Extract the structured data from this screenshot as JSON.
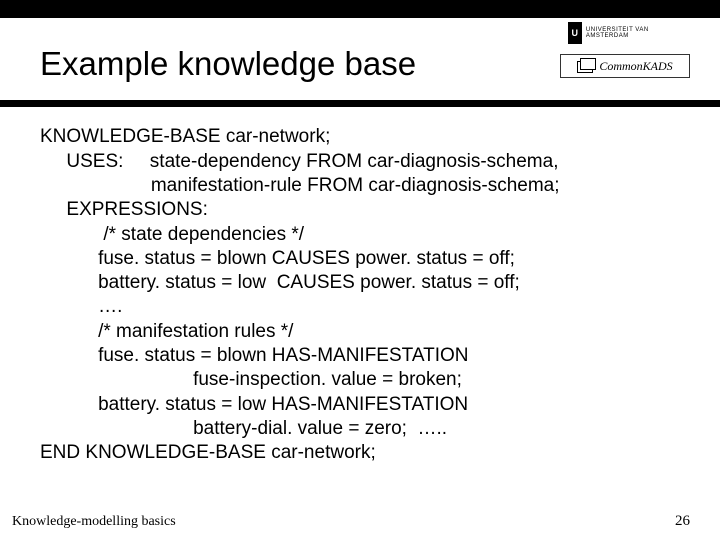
{
  "header": {
    "title": "Example knowledge base"
  },
  "logos": {
    "uva_text": "UNIVERSITEIT VAN AMSTERDAM",
    "ck_text": "CommonKADS"
  },
  "kb": {
    "line1": "KNOWLEDGE-BASE car-network;",
    "line2": "     USES:     state-dependency FROM car-diagnosis-schema,",
    "line3": "                     manifestation-rule FROM car-diagnosis-schema;",
    "line4": "     EXPRESSIONS:",
    "line5": "            /* state dependencies */",
    "line6": "           fuse. status = blown CAUSES power. status = off;",
    "line7": "           battery. status = low  CAUSES power. status = off;",
    "line8": "           ….",
    "line9": "           /* manifestation rules */",
    "line10": "           fuse. status = blown HAS-MANIFESTATION",
    "line11": "                             fuse-inspection. value = broken;",
    "line12": "           battery. status = low HAS-MANIFESTATION",
    "line13": "                             battery-dial. value = zero;  …..",
    "line14": "END KNOWLEDGE-BASE car-network;"
  },
  "footer": {
    "left": "Knowledge-modelling basics",
    "page": "26"
  }
}
